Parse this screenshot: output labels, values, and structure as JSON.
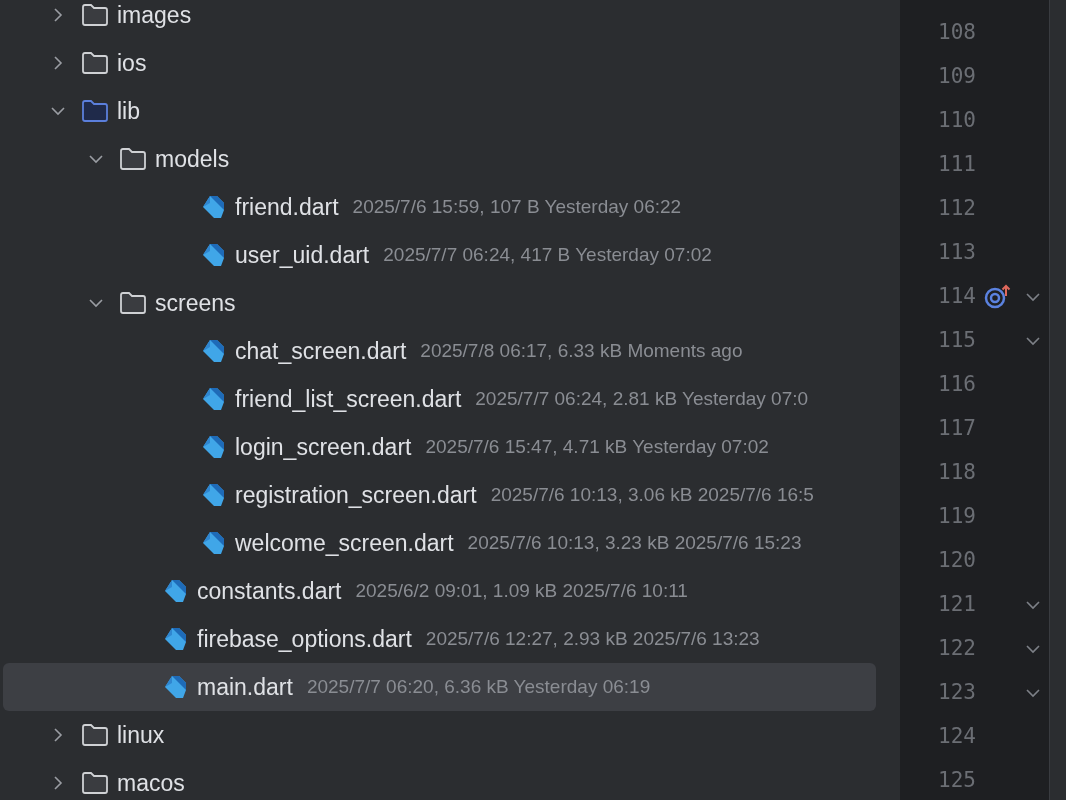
{
  "tree": [
    {
      "kind": "folder",
      "name": "images",
      "expanded": false,
      "selected": false
    },
    {
      "kind": "folder",
      "name": "ios",
      "expanded": false,
      "selected": false
    },
    {
      "kind": "source_folder",
      "name": "lib",
      "expanded": true,
      "selected": false,
      "children": [
        {
          "kind": "folder",
          "name": "models",
          "expanded": true,
          "selected": false,
          "children": [
            {
              "kind": "dart_file",
              "name": "friend.dart",
              "meta": "2025/7/6 15:59, 107 B Yesterday 06:22",
              "selected": false
            },
            {
              "kind": "dart_file",
              "name": "user_uid.dart",
              "meta": "2025/7/7 06:24, 417 B Yesterday 07:02",
              "selected": false
            }
          ]
        },
        {
          "kind": "folder",
          "name": "screens",
          "expanded": true,
          "selected": false,
          "children": [
            {
              "kind": "dart_file",
              "name": "chat_screen.dart",
              "meta": "2025/7/8 06:17, 6.33 kB Moments ago",
              "selected": false
            },
            {
              "kind": "dart_file",
              "name": "friend_list_screen.dart",
              "meta": "2025/7/7 06:24, 2.81 kB Yesterday 07:0",
              "selected": false
            },
            {
              "kind": "dart_file",
              "name": "login_screen.dart",
              "meta": "2025/7/6 15:47, 4.71 kB Yesterday 07:02",
              "selected": false
            },
            {
              "kind": "dart_file",
              "name": "registration_screen.dart",
              "meta": "2025/7/6 10:13, 3.06 kB 2025/7/6 16:5",
              "selected": false
            },
            {
              "kind": "dart_file",
              "name": "welcome_screen.dart",
              "meta": "2025/7/6 10:13, 3.23 kB 2025/7/6 15:23",
              "selected": false
            }
          ]
        },
        {
          "kind": "dart_file",
          "name": "constants.dart",
          "meta": "2025/6/2 09:01, 1.09 kB 2025/7/6 10:11",
          "selected": false
        },
        {
          "kind": "dart_file",
          "name": "firebase_options.dart",
          "meta": "2025/7/6 12:27, 2.93 kB 2025/7/6 13:23",
          "selected": false
        },
        {
          "kind": "dart_file",
          "name": "main.dart",
          "meta": "2025/7/7 06:20, 6.36 kB Yesterday 06:19",
          "selected": true
        }
      ]
    },
    {
      "kind": "folder",
      "name": "linux",
      "expanded": false,
      "selected": false
    },
    {
      "kind": "folder",
      "name": "macos",
      "expanded": false,
      "selected": false
    }
  ],
  "gutter": [
    {
      "number": "108",
      "marker": false,
      "fold": false
    },
    {
      "number": "109",
      "marker": false,
      "fold": false
    },
    {
      "number": "110",
      "marker": false,
      "fold": false
    },
    {
      "number": "111",
      "marker": false,
      "fold": false
    },
    {
      "number": "112",
      "marker": false,
      "fold": false
    },
    {
      "number": "113",
      "marker": false,
      "fold": false
    },
    {
      "number": "114",
      "marker": true,
      "fold": true
    },
    {
      "number": "115",
      "marker": false,
      "fold": true
    },
    {
      "number": "116",
      "marker": false,
      "fold": false
    },
    {
      "number": "117",
      "marker": false,
      "fold": false
    },
    {
      "number": "118",
      "marker": false,
      "fold": false
    },
    {
      "number": "119",
      "marker": false,
      "fold": false
    },
    {
      "number": "120",
      "marker": false,
      "fold": false
    },
    {
      "number": "121",
      "marker": false,
      "fold": true
    },
    {
      "number": "122",
      "marker": false,
      "fold": true
    },
    {
      "number": "123",
      "marker": false,
      "fold": true
    },
    {
      "number": "124",
      "marker": false,
      "fold": false
    },
    {
      "number": "125",
      "marker": false,
      "fold": false
    }
  ]
}
